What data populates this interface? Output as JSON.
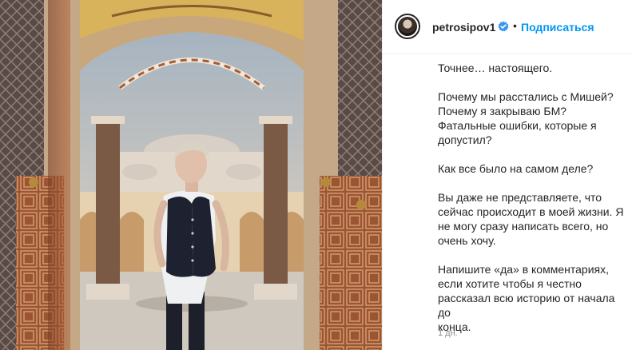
{
  "post": {
    "username": "petrosipov1",
    "separator": "•",
    "follow_label": "Подписаться",
    "caption_lines": [
      "Точнее… настоящего.",
      "Почему мы расстались с Мишей?\nПочему я закрываю БМ?\nФатальные ошибки, которые я\nдопустил?",
      "Как все было на самом деле?",
      "Вы даже не представляете, что\nсейчас происходит в моей жизни. Я\nне могу сразу написать всего, но\nочень хочу.",
      "Напишите «да» в комментариях,\nесли хотите чтобы я честно\nрассказал всю историю от начала до\nконца."
    ],
    "timestamp": "1 дн."
  },
  "icons": {
    "verified": "verified-badge-icon",
    "verified_color": "#3897f0"
  },
  "colors": {
    "follow": "#0095f6",
    "text": "#262626",
    "muted": "#8e8e8e"
  }
}
